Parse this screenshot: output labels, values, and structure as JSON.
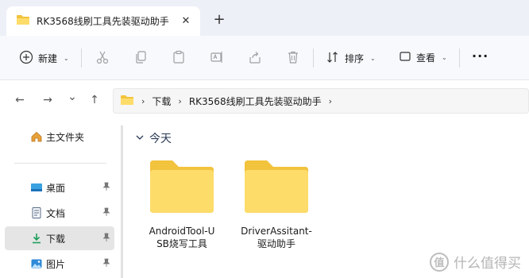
{
  "window": {
    "tab_title": "RK3568线刷工具先装驱动助手",
    "close_glyph": "✕",
    "new_tab_glyph": "+"
  },
  "toolbar": {
    "new_label": "新建",
    "sort_label": "排序",
    "view_label": "查看",
    "more_glyph": "···",
    "chevron_glyph": "⌄"
  },
  "navigation": {
    "back_glyph": "←",
    "forward_glyph": "→",
    "recent_glyph": "⌄",
    "up_glyph": "↑"
  },
  "address": {
    "separator": "›",
    "crumbs": [
      "下载",
      "RK3568线刷工具先装驱动助手"
    ]
  },
  "sidebar": {
    "pin_glyph": "📌",
    "home_label": "主文件夹",
    "items": [
      {
        "label": "桌面",
        "icon": "desktop-icon",
        "pinned": true,
        "active": false
      },
      {
        "label": "文档",
        "icon": "document-icon",
        "pinned": true,
        "active": false
      },
      {
        "label": "下载",
        "icon": "download-icon",
        "pinned": true,
        "active": true
      },
      {
        "label": "图片",
        "icon": "pictures-icon",
        "pinned": true,
        "active": false
      }
    ]
  },
  "content": {
    "group_title": "今天",
    "group_chevron": "⌄",
    "folders": [
      {
        "name": "AndroidTool-U\nSB烧写工具"
      },
      {
        "name": "DriverAssitant-\n驱动助手"
      }
    ]
  },
  "watermark": {
    "glyph": "值",
    "text": "什么值得买"
  },
  "colors": {
    "folder_back": "#f2c33d",
    "folder_front": "#fddc6a",
    "accent": "#1f6fd1"
  }
}
